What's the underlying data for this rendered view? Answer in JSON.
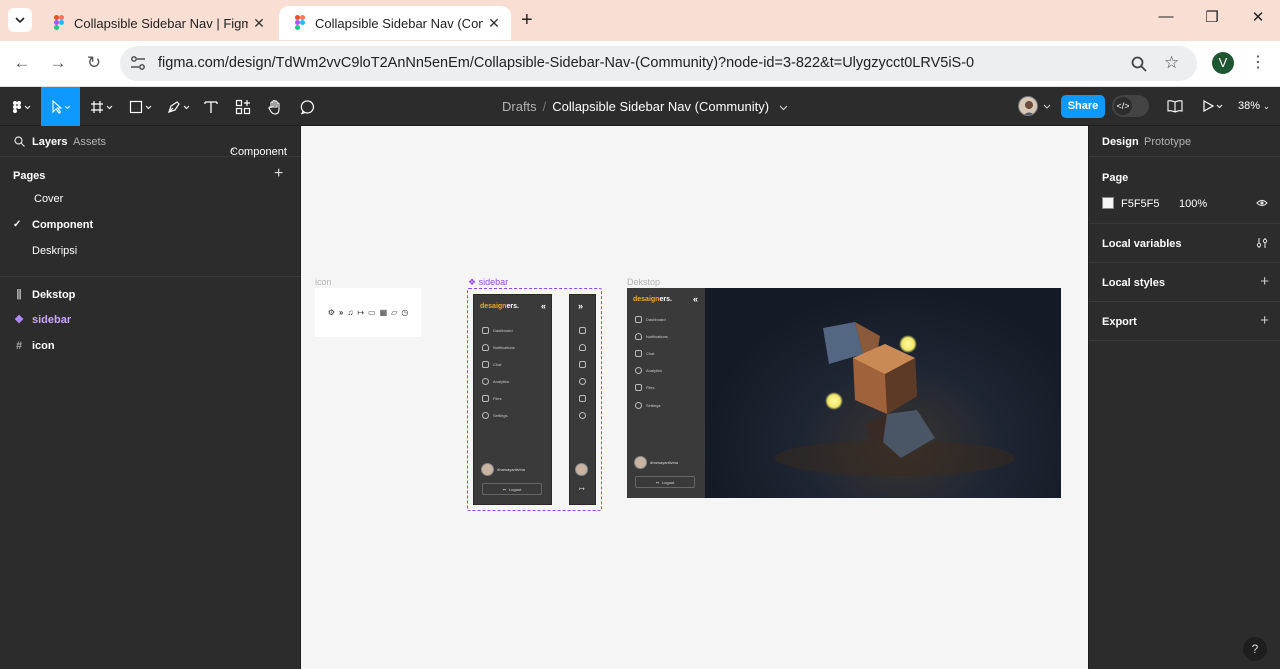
{
  "browser": {
    "tabs": [
      {
        "title": "Collapsible Sidebar Nav | Figma",
        "active": false
      },
      {
        "title": "Collapsible Sidebar Nav (Comm",
        "active": true
      }
    ],
    "url": "figma.com/design/TdWm2vvC9loT2AnNn5enEm/Collapsible-Sidebar-Nav-(Community)?node-id=3-822&t=Ulygzycct0LRV5iS-0",
    "profile_initial": "V"
  },
  "toolbar": {
    "breadcrumb_parent": "Drafts",
    "breadcrumb_sep": "/",
    "file_name": "Collapsible Sidebar Nav (Community)",
    "share_label": "Share",
    "zoom": "38%"
  },
  "left_panel": {
    "tab_layers": "Layers",
    "tab_assets": "Assets",
    "current_page_dropdown": "Component",
    "pages_title": "Pages",
    "pages": [
      {
        "label": "Cover",
        "selected": false
      },
      {
        "label": "Component",
        "selected": true
      },
      {
        "label": "Deskripsi",
        "selected": false
      }
    ],
    "layers": [
      {
        "label": "Dekstop",
        "type": "frame"
      },
      {
        "label": "sidebar",
        "type": "component-set"
      },
      {
        "label": "icon",
        "type": "frame"
      }
    ]
  },
  "right_panel": {
    "tab_design": "Design",
    "tab_prototype": "Prototype",
    "page_title": "Page",
    "page_color_hex": "F5F5F5",
    "page_opacity": "100%",
    "local_variables": "Local variables",
    "local_styles": "Local styles",
    "export": "Export"
  },
  "canvas": {
    "frame_icon_label": "icon",
    "frame_sidebar_label": "sidebar",
    "frame_desktop_label": "Dekstop",
    "logo_accent": "desaign",
    "logo_rest": "ers.",
    "nav_items": [
      "Dashboard",
      "Notifications",
      "Chat",
      "Analytics",
      "Files",
      "Settings"
    ],
    "username": "dhamayantivina",
    "logout": "Logout",
    "collapse_chevron": "«",
    "expand_chevron": "»"
  },
  "help": "?",
  "colors": {
    "accent": "#0d99ff",
    "component": "#9747ff",
    "panel": "#2c2c2c",
    "canvas": "#f5f5f5",
    "tabstrip": "#f9dfd3"
  }
}
